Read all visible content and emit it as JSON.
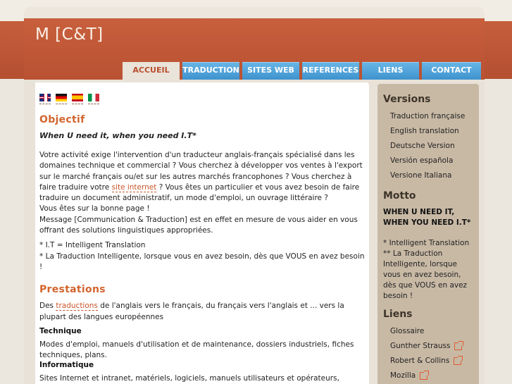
{
  "site": {
    "title": "M [C&T]"
  },
  "nav": [
    {
      "label": "ACCUEIL",
      "active": true
    },
    {
      "label": "TRADUCTION",
      "active": false
    },
    {
      "label": "SITES WEB",
      "active": false
    },
    {
      "label": "REFERENCES",
      "active": false
    },
    {
      "label": "LIENS",
      "active": false
    },
    {
      "label": "CONTACT",
      "active": false
    }
  ],
  "flags": [
    "uk-flag-icon",
    "germany-flag-icon",
    "spain-flag-icon",
    "italy-flag-icon"
  ],
  "content": {
    "objectif_title": "Objectif",
    "slogan": "When U need it, when you need I.T*",
    "p1_before": "Votre activité exige l'intervention d'un traducteur anglais-français spécialisé dans les domaines technique et commercial ? Vous cherchez à développer vos ventes à l'export sur le marché français ou/et sur les autres marchés francophones ? Vous cherchez à faire traduire votre ",
    "p1_link": "site internet",
    "p1_after": " ? Vous êtes un particulier et vous avez besoin de faire traduire un document administratif, un mode d'emploi, un ouvrage littéraire ?",
    "p1_line2": "Vous êtes sur la bonne page !",
    "p1_line3": "Message [Communication & Traduction] est en effet en mesure de vous aider en vous offrant des solutions linguistiques appropriées.",
    "note1": "* I.T = Intelligent Translation",
    "note2": "* La Traduction Intelligente, lorsque vous en avez besoin, dès que VOUS en avez besoin !",
    "prestations_title": "Prestations",
    "prest_before": "Des ",
    "prest_link": "traductions",
    "prest_after": " de l'anglais vers le français, du français vers l'anglais et ... vers la plupart des langues européennes",
    "technique_title": "Technique",
    "technique_text": "Modes d'emploi, manuels d'utilisation et de maintenance, dossiers industriels, fiches techniques, plans.",
    "informatique_title": "Informatique",
    "informatique_text": "Sites Internet et intranet, matériels, logiciels, manuels utilisateurs et opérateurs, notices, jeux"
  },
  "sidebar": {
    "versions_title": "Versions",
    "versions": [
      "Traduction française",
      "English translation",
      "Deutsche Version",
      "Versión española",
      "Versione Italiana"
    ],
    "motto_title": "Motto",
    "motto_text": "WHEN U NEED IT, WHEN YOU NEED I.T*",
    "motto_note": "* Intelligent Translation ** La Traduction Intelligente, lorsque vous en avez besoin, dès que VOUS en avez besoin !",
    "liens_title": "Liens",
    "liens": [
      {
        "label": "Glossaire",
        "external": false
      },
      {
        "label": "Gunther Strauss",
        "external": true
      },
      {
        "label": "Robert & Collins",
        "external": true
      },
      {
        "label": "Mozilla",
        "external": true
      }
    ]
  },
  "colors": {
    "header": "#c45e3c",
    "nav_tab": "#4a9fd8",
    "accent": "#d2652d",
    "sidebar": "#c8b9a5"
  }
}
